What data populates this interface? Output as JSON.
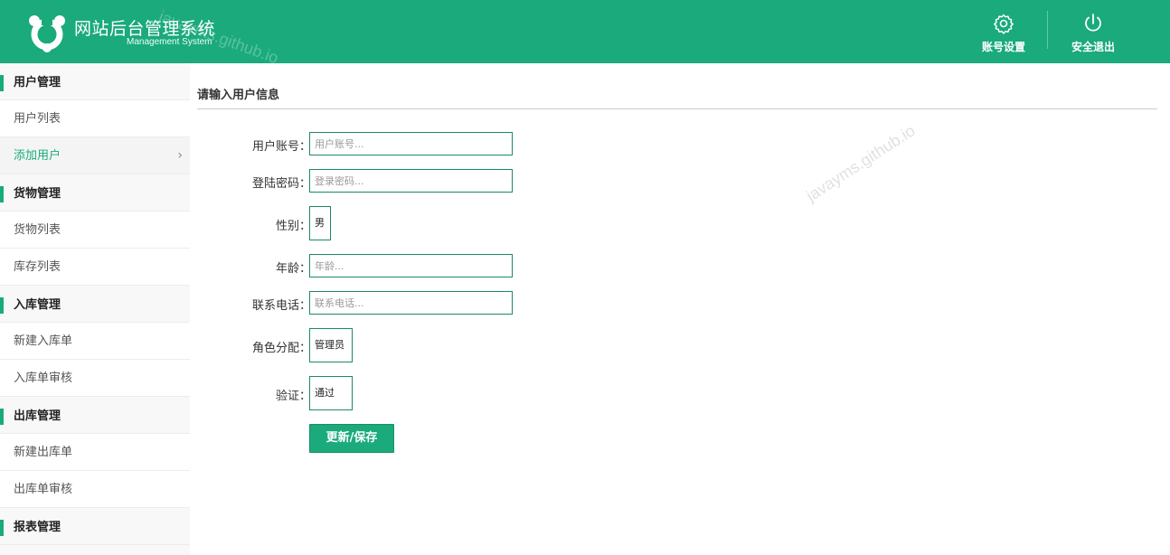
{
  "header": {
    "title": "网站后台管理系统",
    "subtitle": "Management System",
    "watermark": "javayms.github.io",
    "account_label": "账号设置",
    "logout_label": "安全退出",
    "brand_color": "#1aaa7b"
  },
  "sidebar": {
    "items": [
      {
        "type": "group",
        "label": "用户管理"
      },
      {
        "type": "item",
        "label": "用户列表"
      },
      {
        "type": "item",
        "label": "添加用户",
        "active": true,
        "chevron": "›"
      },
      {
        "type": "group",
        "label": "货物管理"
      },
      {
        "type": "item",
        "label": "货物列表"
      },
      {
        "type": "item",
        "label": "库存列表"
      },
      {
        "type": "group",
        "label": "入库管理"
      },
      {
        "type": "item",
        "label": "新建入库单"
      },
      {
        "type": "item",
        "label": "入库单审核"
      },
      {
        "type": "group",
        "label": "出库管理"
      },
      {
        "type": "item",
        "label": "新建出库单"
      },
      {
        "type": "item",
        "label": "出库单审核"
      },
      {
        "type": "group",
        "label": "报表管理"
      }
    ]
  },
  "form": {
    "title": "请输入用户信息",
    "watermark": "javayms.github.io",
    "account": {
      "label": "用户账号：",
      "placeholder": "用户账号..."
    },
    "password": {
      "label": "登陆密码：",
      "placeholder": "登录密码..."
    },
    "gender": {
      "label": "性别：",
      "value": "男"
    },
    "age": {
      "label": "年龄：",
      "placeholder": "年龄..."
    },
    "phone": {
      "label": "联系电话：",
      "placeholder": "联系电话..."
    },
    "role": {
      "label": "角色分配：",
      "value": "管理员"
    },
    "verify": {
      "label": "验证：",
      "value": "通过"
    },
    "save_label": "更新/保存"
  }
}
